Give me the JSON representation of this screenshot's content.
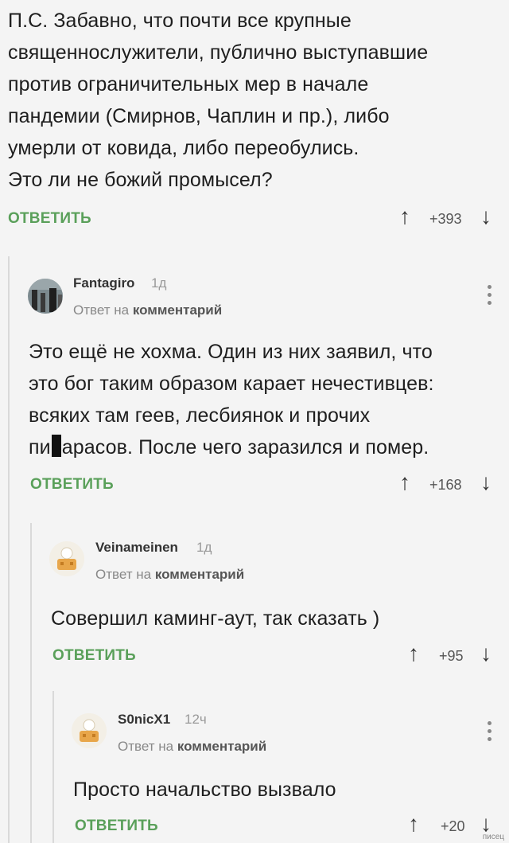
{
  "comments": [
    {
      "lines": [
        "П.С. Забавно, что почти все крупные",
        "священнослужители, публично выступавшие",
        "против ограничительных мер в начале",
        "пандемии (Смирнов, Чаплин и пр.), либо",
        "умерли от ковида, либо переобулись.",
        "Это ли не божий промысел?"
      ],
      "reply_label": "ОТВЕТИТЬ",
      "score": "+393"
    },
    {
      "author": "Fantagiro",
      "time": "1д",
      "reply_to_prefix": "Ответ на",
      "reply_to_target": "комментарий",
      "lines": [
        "Это ещё не хохма. Один из них заявил, что",
        "это бог таким образом карает нечестивцев:",
        "всяких там геев, лесбиянок и прочих"
      ],
      "line_last_before": "пи",
      "line_last_after": "арасов. После чего заразился и помер.",
      "reply_label": "ОТВЕТИТЬ",
      "score": "+168"
    },
    {
      "author": "Veinameinen",
      "time": "1д",
      "reply_to_prefix": "Ответ на",
      "reply_to_target": "комментарий",
      "lines": [
        "Совершил каминг-аут, так сказать )"
      ],
      "reply_label": "ОТВЕТИТЬ",
      "score": "+95"
    },
    {
      "author": "S0nicX1",
      "time": "12ч",
      "reply_to_prefix": "Ответ на",
      "reply_to_target": "комментарий",
      "lines": [
        "Просто начальство вызвало"
      ],
      "reply_label": "ОТВЕТИТЬ",
      "score": "+20"
    }
  ],
  "watermark": "писец",
  "colors": {
    "reply": "#5aa05a",
    "thread_line": "#d9d9d9",
    "background": "#f4f4f4"
  },
  "icons": {
    "upvote": "arrow-up-icon",
    "downvote": "arrow-down-icon",
    "menu": "more-vertical-icon"
  }
}
